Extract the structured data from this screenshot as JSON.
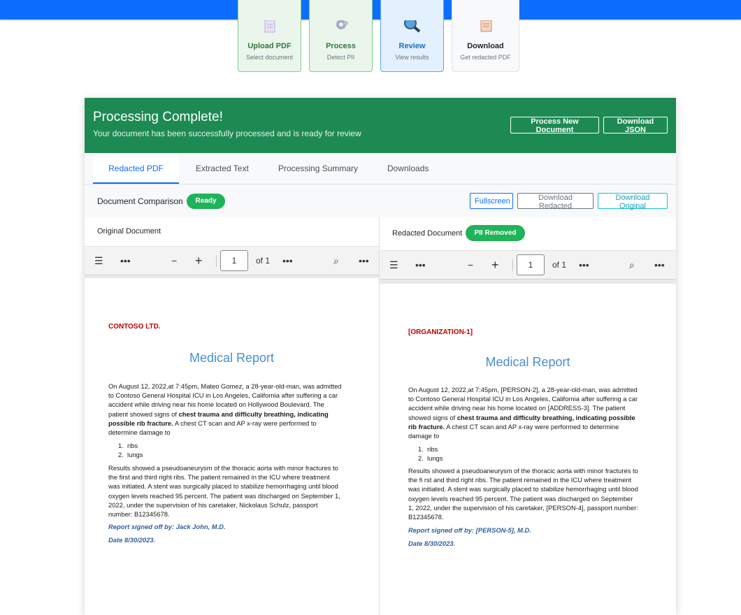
{
  "steps": [
    {
      "title": "Upload PDF",
      "subtitle": "Select document",
      "state": "done",
      "icon": "document-icon"
    },
    {
      "title": "Process",
      "subtitle": "Detect PII",
      "state": "done",
      "icon": "gear-icon"
    },
    {
      "title": "Review",
      "subtitle": "View results",
      "state": "active",
      "icon": "magnifier-icon"
    },
    {
      "title": "Download",
      "subtitle": "Get redacted PDF",
      "state": "plain",
      "icon": "report-icon"
    }
  ],
  "header": {
    "title": "Processing Complete!",
    "subtitle": "Your document has been successfully processed and is ready for review",
    "btn_new": "Process New Document",
    "btn_json": "Download JSON"
  },
  "tabs": [
    "Redacted PDF",
    "Extracted Text",
    "Processing Summary",
    "Downloads"
  ],
  "comparison": {
    "label": "Document Comparison",
    "status": "Ready",
    "btn_fullscreen": "Fullscreen",
    "btn_redacted": "Download Redacted",
    "btn_original": "Download Original"
  },
  "viewer": {
    "page": "1",
    "of": "of 1"
  },
  "original": {
    "label": "Original Document",
    "org": "CONTOSO LTD.",
    "title": "Medical Report",
    "p1_a": "On August 12, 2022,at 7:45pm, Mateo Gomez, a 28-year-old-man, was admitted to Contoso General Hospital ICU in Los Angeles, California after suffering a car accident while driving near his home located on Hollywood Boulevard. The patient showed signs of ",
    "p1_b": "chest trauma and difficulty breathing, indicating possible rib fracture.",
    "p1_c": " A chest CT scan and AP x-ray were performed to determine damage to",
    "list": [
      "ribs",
      "lungs"
    ],
    "p2": "Results showed a pseudoaneurysm of the thoracic aorta with minor fractures to the first and third right ribs. The patient remained in the ICU where treatment was initiated. A stent was surgically placed to stabilize hemorrhaging until blood oxygen levels reached 95 percent. The patient was discharged on September 1, 2022, under the supervision of his caretaker, Nickolaus Schulz, passport number: B12345678.",
    "sig": "Report signed off by: Jack John, M.D.",
    "date": "Date 8/30/2023."
  },
  "redacted": {
    "label": "Redacted Document",
    "status": "PII Removed",
    "org": "[ORGANIZATION-1]",
    "title": "Medical Report",
    "p1_a": "On August 12, 2022,at 7:45pm, [PERSON-2], a 28-year-old-man, was admitted to Contoso General Hospital ICU in Los Angeles, California after suffering a car accident while driving near his home located on [ADDRESS-3]. The patient showed signs of ",
    "p1_b": "chest trauma and difficulty breathing, indicating possible rib fracture.",
    "p1_c": " A chest CT scan and AP x-ray were performed to determine damage to",
    "list": [
      "ribs",
      "lungs"
    ],
    "p2": "Results showed a pseudoaneurysm of the thoracic aorta with minor fractures to the fi rst and third right ribs. The patient remained in the ICU where treatment was initiated. A stent was surgically placed to stabilize hemorrhaging until blood oxygen levels reached 95 percent. The patient was discharged on September 1, 2022, under the supervision of his caretaker, [PERSON-4], passport number: B12345678.",
    "sig": "Report signed off by: [PERSON-5], M.D.",
    "date": "Date 8/30/2023."
  },
  "colors": {
    "topbar": "#0d6efd",
    "header": "#1e8a53",
    "pill": "#1fb35a",
    "org": "#c00000",
    "title": "#4a8ecf",
    "sig": "#2f5f9e"
  }
}
